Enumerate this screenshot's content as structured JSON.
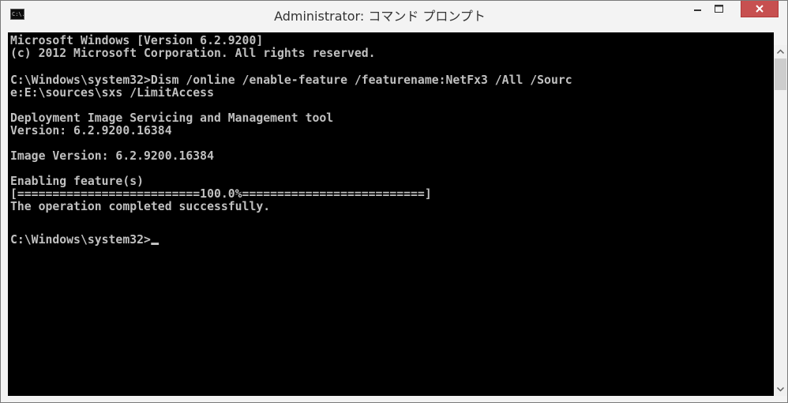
{
  "window": {
    "title": "Administrator: コマンド プロンプト",
    "app_icon_label": "C:\\."
  },
  "console": {
    "lines": [
      "Microsoft Windows [Version 6.2.9200]",
      "(c) 2012 Microsoft Corporation. All rights reserved.",
      "",
      "C:\\Windows\\system32>Dism /online /enable-feature /featurename:NetFx3 /All /Sourc",
      "e:E:\\sources\\sxs /LimitAccess",
      "",
      "Deployment Image Servicing and Management tool",
      "Version: 6.2.9200.16384",
      "",
      "Image Version: 6.2.9200.16384",
      "",
      "Enabling feature(s)",
      "[==========================100.0%==========================]",
      "The operation completed successfully.",
      "",
      "C:\\Windows\\system32>"
    ]
  },
  "colors": {
    "console_bg": "#000000",
    "console_text": "#c0c0c0",
    "close_button": "#c75050"
  },
  "icons": {
    "app": "cmd-icon",
    "minimize": "minimize-icon",
    "maximize": "maximize-icon",
    "close": "close-icon",
    "scroll_up": "chevron-up-icon",
    "scroll_down": "chevron-down-icon"
  }
}
